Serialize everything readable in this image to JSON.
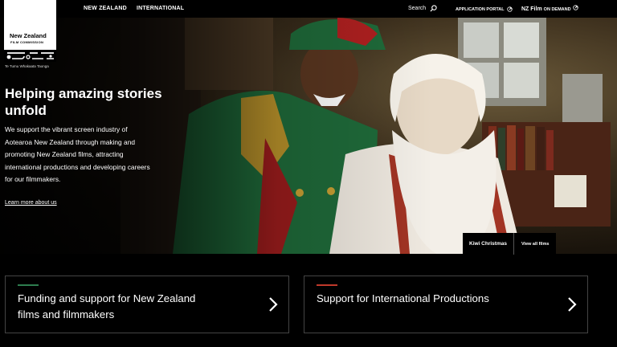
{
  "header": {
    "nav": [
      "NEW ZEALAND",
      "INTERNATIONAL"
    ],
    "search_label": "Search",
    "portal_label": "APPLICATION PORTAL",
    "nzfilm_label": "NZ Film",
    "ondemand_label": "ON DEMAND"
  },
  "logo": {
    "line1": "New Zealand",
    "line2": "FILM COMMISSION",
    "tagline": "Te Tumu Whakaata Taonga"
  },
  "hero": {
    "headline": "Helping amazing stories unfold",
    "intro": "We support the vibrant screen industry of Aotearoa New Zealand through making and promoting New Zealand films, attracting international productions and developing careers for our filmmakers.",
    "learn_more": "Learn more about us",
    "caption_title": "Kiwi Christmas",
    "caption_link": "View all films"
  },
  "cards": [
    {
      "label": "Funding and support for New Zealand films and filmmakers",
      "accent": "#2e7d4f"
    },
    {
      "label": "Support for International Productions",
      "accent": "#c0392b"
    }
  ],
  "colors": {
    "background": "#000000",
    "text": "#ffffff",
    "border": "#444444"
  },
  "icons": [
    "search-icon",
    "external-link-icon",
    "chevron-right-icon"
  ]
}
